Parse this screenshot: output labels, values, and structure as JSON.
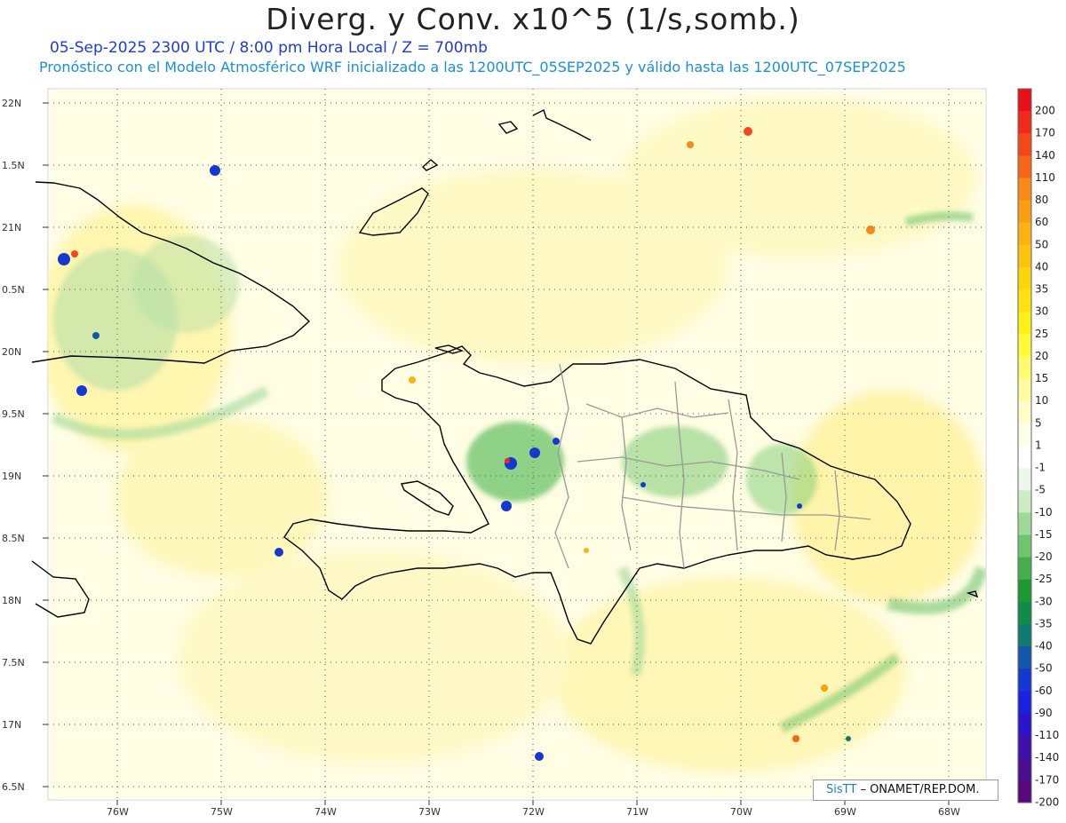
{
  "header": {
    "title": "Diverg. y Conv. x10^5 (1/s,somb.)",
    "line1": "05-Sep-2025  2300 UTC / 8:00 pm Hora Local / Z = 700mb",
    "line2": "Pronóstico con el Modelo Atmosférico WRF inicializado a las 1200UTC_05SEP2025 y válido hasta las  1200UTC_07SEP2025"
  },
  "map": {
    "lat_labels": [
      "22N",
      "1.5N",
      "21N",
      "0.5N",
      "20N",
      "9.5N",
      "19N",
      "8.5N",
      "18N",
      "7.5N",
      "17N",
      "6.5N"
    ],
    "lon_labels": [
      "76W",
      "75W",
      "74W",
      "73W",
      "72W",
      "71W",
      "70W",
      "69W",
      "68W"
    ],
    "grid": true
  },
  "colorbar": {
    "labels": [
      "200",
      "170",
      "140",
      "110",
      "80",
      "60",
      "50",
      "40",
      "35",
      "30",
      "25",
      "20",
      "15",
      "10",
      "5",
      "1",
      "-1",
      "-5",
      "-10",
      "-15",
      "-20",
      "-25",
      "-30",
      "-35",
      "-40",
      "-50",
      "-60",
      "-90",
      "-110",
      "-140",
      "-170",
      "-200"
    ],
    "colors": [
      "#e8101a",
      "#f02a1a",
      "#f5471a",
      "#f76518",
      "#f88a16",
      "#fa9e14",
      "#fcb212",
      "#fdc40f",
      "#fed40d",
      "#ffe20f",
      "#fff018",
      "#fffb3a",
      "#fffb70",
      "#fffca0",
      "#fffdc8",
      "#fffee6",
      "#ffffff",
      "#eef8ea",
      "#cdecc6",
      "#9fd99a",
      "#6fc46e",
      "#45b04a",
      "#1c9a31",
      "#128a4a",
      "#0f7a70",
      "#1258a8",
      "#1538d0",
      "#1a22e0",
      "#2c14c8",
      "#3c12aa",
      "#4a0f90",
      "#58087a"
    ]
  },
  "colors": {
    "yellow": "#fffbb0",
    "green": "#4cb04c",
    "blue": "#1030d0"
  },
  "credit": {
    "logo": "SisTT",
    "text": "– ONAMET/REP.DOM."
  }
}
